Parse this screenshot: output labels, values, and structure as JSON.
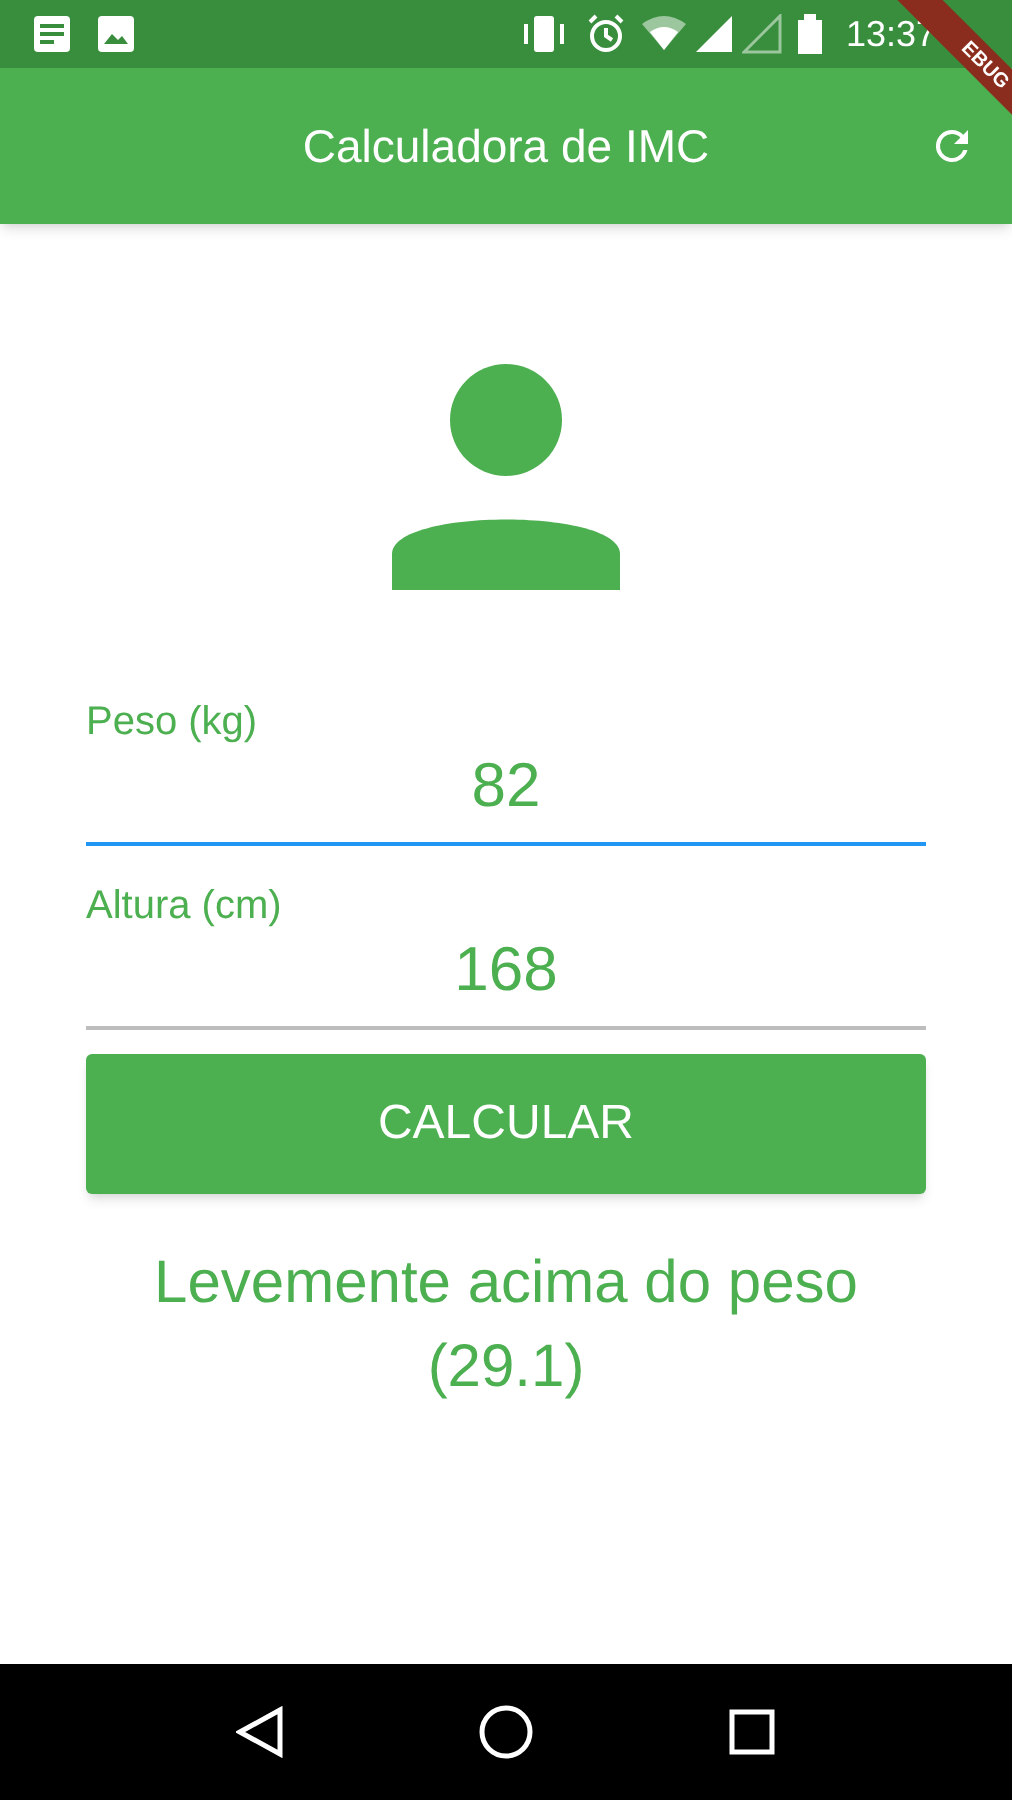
{
  "status_bar": {
    "time": "13:37"
  },
  "debug_banner": {
    "label": "EBUG"
  },
  "app_bar": {
    "title": "Calculadora de IMC"
  },
  "fields": [
    {
      "label": "Peso (kg)",
      "value": "82",
      "focused": true
    },
    {
      "label": "Altura (cm)",
      "value": "168",
      "focused": false
    }
  ],
  "button": {
    "label": "CALCULAR"
  },
  "result": {
    "text": "Levemente acima do peso (29.1)"
  }
}
